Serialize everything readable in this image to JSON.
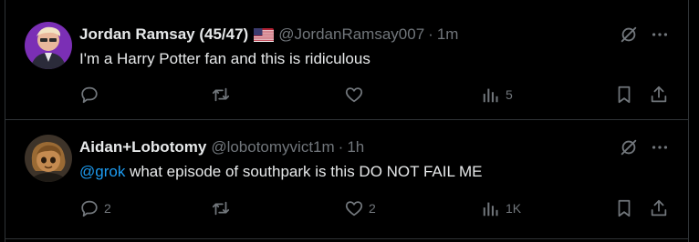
{
  "tweets": [
    {
      "name": "Jordan Ramsay (45/47)",
      "has_flag": true,
      "handle": "@JordanRamsay007",
      "separator": "·",
      "time": "1m",
      "text_mention": "",
      "text": "I'm a Harry Potter fan and this is ridiculous",
      "replies": "",
      "retweets": "",
      "likes": "",
      "views": "5"
    },
    {
      "name": "Aidan+Lobotomy",
      "has_flag": false,
      "handle": "@lobotomyvict1m",
      "separator": "·",
      "time": "1h",
      "text_mention": "@grok",
      "text": " what episode of southpark is this DO NOT FAIL ME",
      "replies": "2",
      "retweets": "",
      "likes": "2",
      "views": "1K"
    }
  ],
  "icons": {
    "grok": "grok-icon",
    "more": "more-icon",
    "reply": "reply-icon",
    "retweet": "retweet-icon",
    "like": "like-icon",
    "views": "views-icon",
    "bookmark": "bookmark-icon",
    "share": "share-icon"
  },
  "colors": {
    "background": "#000000",
    "text": "#e7e9ea",
    "secondary": "#71767b",
    "mention": "#1d9bf0",
    "border": "#2f3336"
  }
}
